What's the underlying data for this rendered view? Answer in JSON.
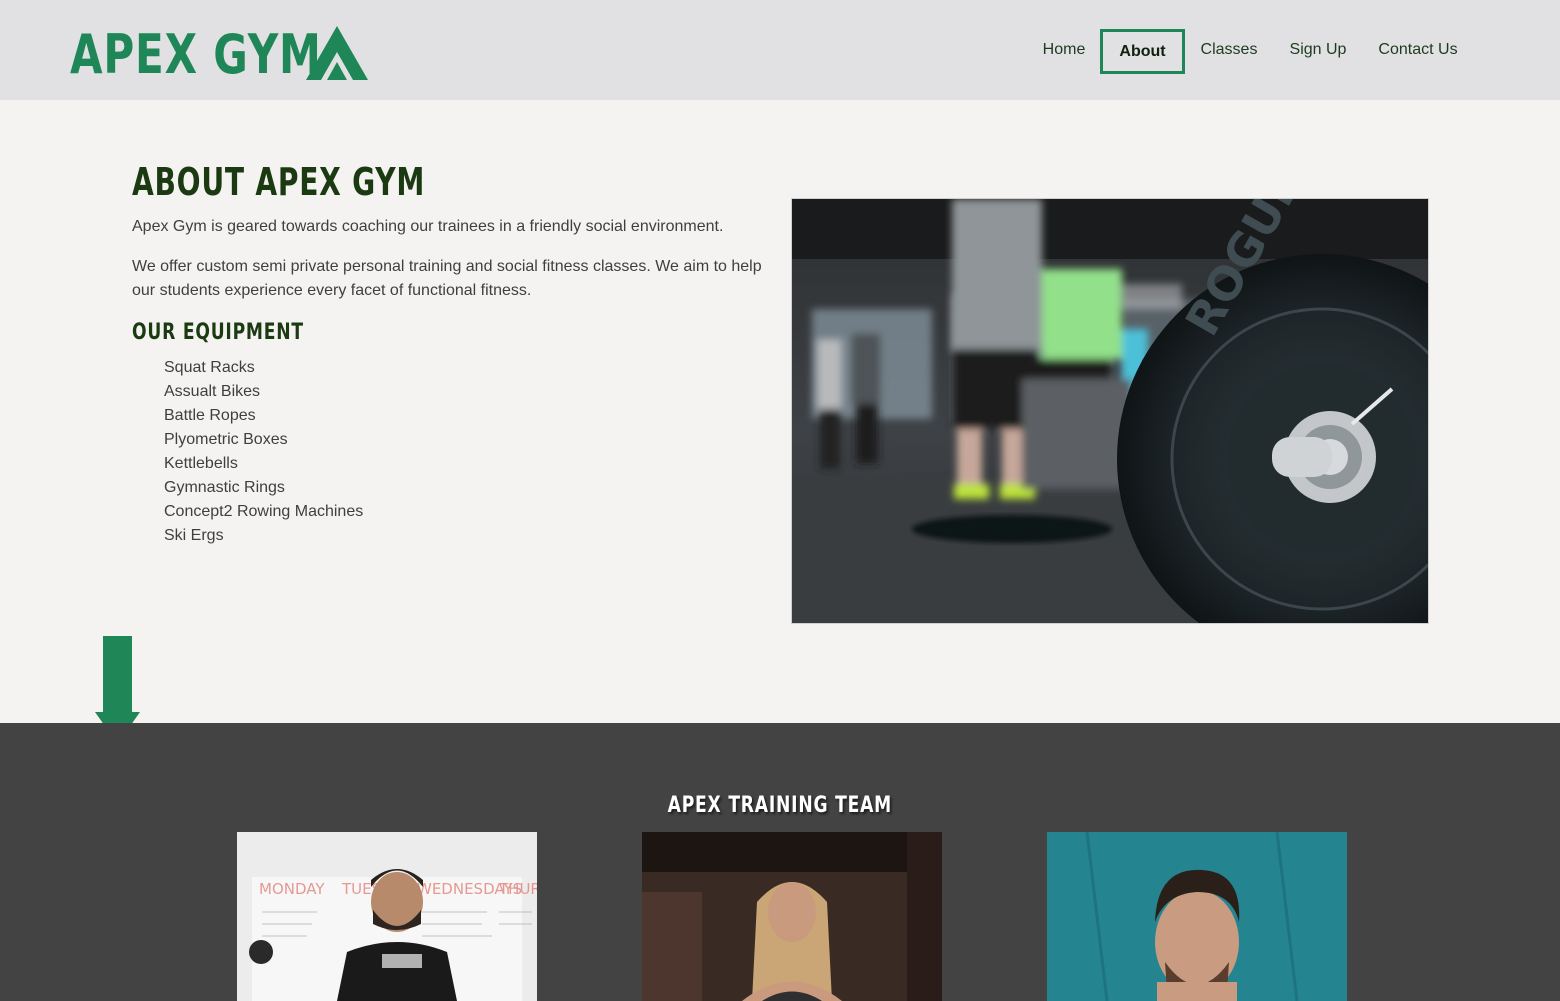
{
  "header": {
    "logo_text": "APEX GYM",
    "logo_icon": "mountain-icon",
    "nav": [
      {
        "label": "Home",
        "active": false
      },
      {
        "label": "About",
        "active": true
      },
      {
        "label": "Classes",
        "active": false
      },
      {
        "label": "Sign Up",
        "active": false
      },
      {
        "label": "Contact Us",
        "active": false
      }
    ]
  },
  "about": {
    "title": "ABOUT APEX GYM",
    "paragraphs": [
      "Apex Gym is geared towards coaching our trainees in a friendly social environment.",
      "We offer custom semi private personal training and social fitness classes. We aim to help our students experience every facet of functional fitness."
    ],
    "equipment_title": "OUR EQUIPMENT",
    "equipment": [
      "Squat Racks",
      "Assualt Bikes",
      "Battle Ropes",
      "Plyometric Boxes",
      "Kettlebells",
      "Gymnastic Rings",
      "Concept2 Rowing Machines",
      "Ski Ergs"
    ],
    "image_plate_text": "ROGUE",
    "scroll_icon": "arrow-down-icon"
  },
  "team": {
    "title": "APEX TRAINING TEAM",
    "board_days": [
      "MONDAY",
      "TUESDAY",
      "WEDNESDAYS",
      "THUR"
    ]
  },
  "colors": {
    "brand_green": "#1f8757",
    "dark_green": "#1c3a12",
    "header_bg": "#e1e1e3",
    "page_bg": "#f4f3f1",
    "team_bg": "#434343"
  }
}
